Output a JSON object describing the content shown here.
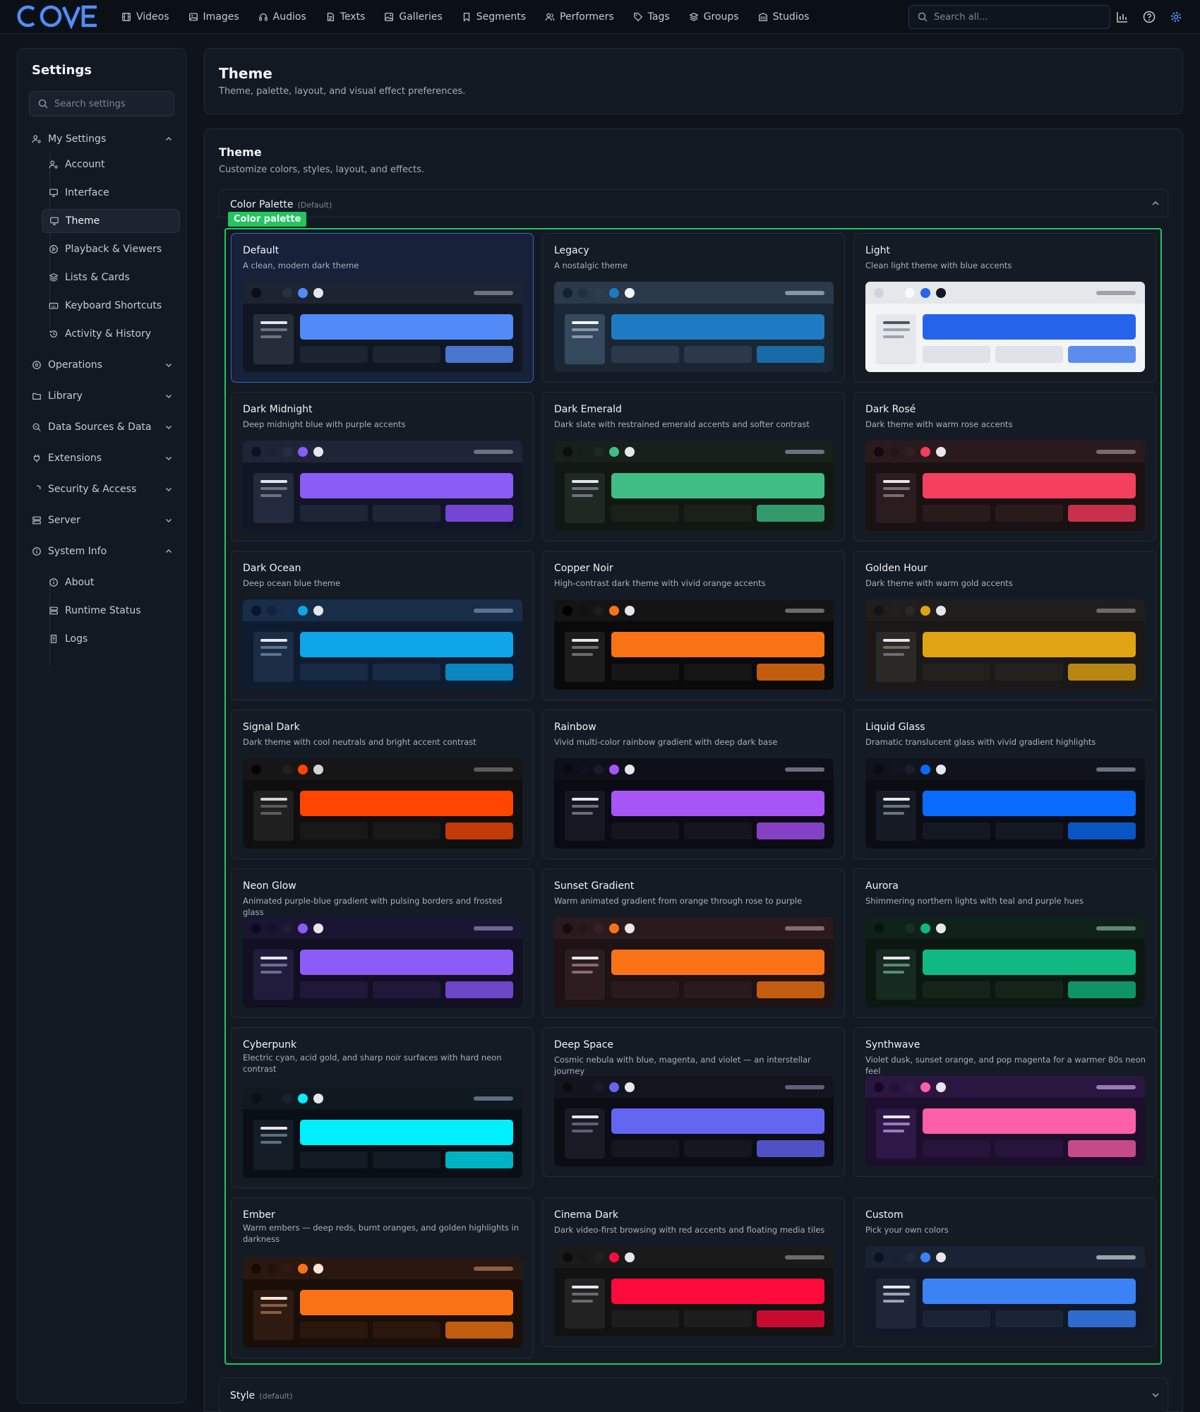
{
  "app": {
    "logo": "COVE",
    "search_placeholder": "Search all..."
  },
  "nav": [
    {
      "label": "Videos",
      "icon": "film-icon"
    },
    {
      "label": "Images",
      "icon": "image-icon"
    },
    {
      "label": "Audios",
      "icon": "headphones-icon"
    },
    {
      "label": "Texts",
      "icon": "file-text-icon"
    },
    {
      "label": "Galleries",
      "icon": "gallery-icon"
    },
    {
      "label": "Segments",
      "icon": "bookmark-icon"
    },
    {
      "label": "Performers",
      "icon": "users-icon"
    },
    {
      "label": "Tags",
      "icon": "tag-icon"
    },
    {
      "label": "Groups",
      "icon": "layers-icon"
    },
    {
      "label": "Studios",
      "icon": "building-icon"
    }
  ],
  "sidebar": {
    "title": "Settings",
    "search_placeholder": "Search settings",
    "groups": [
      {
        "label": "My Settings",
        "icon": "user-cog-icon",
        "expanded": true
      },
      {
        "label": "Operations",
        "icon": "disc-icon",
        "expanded": false
      },
      {
        "label": "Library",
        "icon": "folder-icon",
        "expanded": false
      },
      {
        "label": "Data Sources & Data",
        "icon": "database-search-icon",
        "expanded": false
      },
      {
        "label": "Extensions",
        "icon": "plug-icon",
        "expanded": false
      },
      {
        "label": "Security & Access",
        "icon": "shield-icon",
        "expanded": false
      },
      {
        "label": "Server",
        "icon": "server-icon",
        "expanded": false
      },
      {
        "label": "System Info",
        "icon": "info-icon",
        "expanded": true
      }
    ],
    "my_settings_items": [
      {
        "label": "Account",
        "icon": "user-cog-icon"
      },
      {
        "label": "Interface",
        "icon": "monitor-icon"
      },
      {
        "label": "Theme",
        "icon": "monitor-icon",
        "active": true
      },
      {
        "label": "Playback & Viewers",
        "icon": "play-circle-icon"
      },
      {
        "label": "Lists & Cards",
        "icon": "layers-icon"
      },
      {
        "label": "Keyboard Shortcuts",
        "icon": "keyboard-icon"
      },
      {
        "label": "Activity & History",
        "icon": "history-icon"
      }
    ],
    "system_info_items": [
      {
        "label": "About",
        "icon": "info-icon"
      },
      {
        "label": "Runtime Status",
        "icon": "server-icon"
      },
      {
        "label": "Logs",
        "icon": "logs-icon"
      }
    ]
  },
  "header": {
    "title": "Theme",
    "subtitle": "Theme, palette, layout, and visual effect preferences."
  },
  "section": {
    "title": "Theme",
    "subtitle": "Customize colors, styles, layout, and effects."
  },
  "palette": {
    "title": "Color Palette",
    "default_tag": "(Default)",
    "highlight_label": "Color palette"
  },
  "style": {
    "title": "Style",
    "default_tag": "(default)"
  },
  "themes": [
    {
      "name": "Default",
      "desc": "A clean, modern dark theme",
      "selected": true,
      "colors": {
        "bar": "#1c2331",
        "body": "#111722",
        "dots": [
          "#0b0f16",
          "#1c2331",
          "#283142"
        ],
        "accent": "#528bf7",
        "light": "#e5e7eb",
        "side": "#252d3a",
        "sub": "#1c2331",
        "acc2": "#4a75cf",
        "line": "#6b7280"
      }
    },
    {
      "name": "Legacy",
      "desc": "A nostalgic theme",
      "colors": {
        "bar": "#2a3a4a",
        "body": "#1a2633",
        "dots": [
          "#142230",
          "#1f3040",
          "#2c3e50"
        ],
        "accent": "#1e7ac2",
        "light": "#f3f4f6",
        "side": "#34495e",
        "sub": "#2a3a4a",
        "acc2": "#1a6aa8",
        "line": "#8896a4"
      }
    },
    {
      "name": "Light",
      "desc": "Clean light theme with blue accents",
      "colors": {
        "bar": "#e5e7eb",
        "body": "#f3f4f6",
        "dots": [
          "#d1d5db",
          "#e5e7eb",
          "#f9fafb"
        ],
        "accent": "#2563eb",
        "light": "#111827",
        "side": "#e5e7eb",
        "sub": "#dfe2e8",
        "acc2": "#5b8def",
        "line": "#9ca3af",
        "lnc": "#4b5563"
      }
    },
    {
      "name": "Dark Midnight",
      "desc": "Deep midnight blue with purple accents",
      "colors": {
        "bar": "#1e2537",
        "body": "#111627",
        "dots": [
          "#0c1120",
          "#1b2236",
          "#252d45"
        ],
        "accent": "#8b5cf6",
        "light": "#e5e7eb",
        "side": "#222a3c",
        "sub": "#1e2537",
        "acc2": "#7446d3",
        "line": "#6b7280"
      }
    },
    {
      "name": "Dark Emerald",
      "desc": "Dark slate with restrained emerald accents and softer contrast",
      "colors": {
        "bar": "#172019",
        "body": "#111813",
        "dots": [
          "#0b100c",
          "#162019",
          "#1e2a21"
        ],
        "accent": "#3fbe83",
        "light": "#e5e7eb",
        "side": "#1f2922",
        "sub": "#192119",
        "acc2": "#339b6b",
        "line": "#6b7280"
      }
    },
    {
      "name": "Dark Rosé",
      "desc": "Dark theme with warm rose accents",
      "colors": {
        "bar": "#2b1a1c",
        "body": "#1a1113",
        "dots": [
          "#120a0c",
          "#231517",
          "#351f22"
        ],
        "accent": "#f43f5e",
        "light": "#e5e7eb",
        "side": "#2b1d1f",
        "sub": "#2b1a1c",
        "acc2": "#c9304a",
        "line": "#7a6b6e"
      }
    },
    {
      "name": "Dark Ocean",
      "desc": "Deep ocean blue theme",
      "colors": {
        "bar": "#182d4a",
        "body": "#0f1c30",
        "dots": [
          "#0b1526",
          "#13233c",
          "#1a2f4d"
        ],
        "accent": "#0ea5e9",
        "light": "#e5e7eb",
        "side": "#1b2c45",
        "sub": "#182a44",
        "acc2": "#0b86c0",
        "line": "#5b7290"
      }
    },
    {
      "name": "Copper Noir",
      "desc": "High-contrast dark theme with vivid orange accents",
      "colors": {
        "bar": "#141414",
        "body": "#0a0a0a",
        "dots": [
          "#000000",
          "#111111",
          "#1c1c1c"
        ],
        "accent": "#f97316",
        "light": "#e5e7eb",
        "side": "#1c1c1c",
        "sub": "#161616",
        "acc2": "#c25c0e",
        "line": "#6b6b6b"
      }
    },
    {
      "name": "Golden Hour",
      "desc": "Dark theme with warm gold accents",
      "colors": {
        "bar": "#1f1e1c",
        "body": "#1a1917",
        "dots": [
          "#141311",
          "#22211e",
          "#2b2a26"
        ],
        "accent": "#e0a413",
        "light": "#e5e7eb",
        "side": "#2a2926",
        "sub": "#22211e",
        "acc2": "#b88713",
        "line": "#6b6b6b"
      }
    },
    {
      "name": "Signal Dark",
      "desc": "Dark theme with cool neutrals and bright accent contrast",
      "colors": {
        "bar": "#161616",
        "body": "#0f0f0f",
        "dots": [
          "#050505",
          "#141414",
          "#202020"
        ],
        "accent": "#ff4500",
        "light": "#d4d4d4",
        "side": "#1f1f1f",
        "sub": "#181818",
        "acc2": "#c23a06",
        "line": "#5c5c5c"
      }
    },
    {
      "name": "Rainbow",
      "desc": "Vivid multi-color rainbow gradient with deep dark base",
      "colors": {
        "bar": "#0f0f1a",
        "body": "#0b0b14",
        "dots": [
          "#0a0a12",
          "#12121e",
          "#1a1a28"
        ],
        "accent": "#a855f7",
        "light": "#e5e7eb",
        "side": "#171723",
        "sub": "#151520",
        "acc2": "#8541c4",
        "line": "#6b6b7a"
      }
    },
    {
      "name": "Liquid Glass",
      "desc": "Dramatic translucent glass with vivid gradient highlights",
      "colors": {
        "bar": "#10131b",
        "body": "#0b0d14",
        "dots": [
          "#0a0c12",
          "#121520",
          "#1a1e2a"
        ],
        "accent": "#0a6cff",
        "light": "#e5e7eb",
        "side": "#161a24",
        "sub": "#141822",
        "acc2": "#0a55c4",
        "line": "#6b7280"
      }
    },
    {
      "name": "Neon Glow",
      "desc": "Animated purple-blue gradient with pulsing borders and frosted glass",
      "colors": {
        "bar": "#1a1533",
        "body": "#120f22",
        "dots": [
          "#0d0a1c",
          "#16122b",
          "#221c3c"
        ],
        "accent": "#8b5cf6",
        "light": "#e5e7eb",
        "side": "#221c3c",
        "sub": "#1f1838",
        "acc2": "#6d46c7",
        "line": "#6b6b8f"
      }
    },
    {
      "name": "Sunset Gradient",
      "desc": "Warm animated gradient from orange through rose to purple",
      "colors": {
        "bar": "#2a1a1d",
        "body": "#1e1214",
        "dots": [
          "#140c0e",
          "#241619",
          "#34202a"
        ],
        "accent": "#f97316",
        "light": "#e5e7eb",
        "side": "#2d1c20",
        "sub": "#2a1a1d",
        "acc2": "#c25c0e",
        "line": "#8a6a6a"
      }
    },
    {
      "name": "Aurora",
      "desc": "Shimmering northern lights with teal and purple hues",
      "colors": {
        "bar": "#0f2118",
        "body": "#0c1712",
        "dots": [
          "#081410",
          "#102218",
          "#163020"
        ],
        "accent": "#10b981",
        "light": "#e5e7eb",
        "side": "#162a1f",
        "sub": "#14241b",
        "acc2": "#0e9466",
        "line": "#5a8a70"
      }
    },
    {
      "name": "Cyberpunk",
      "desc": "Electric cyan, acid gold, and sharp noir surfaces with hard neon contrast",
      "colors": {
        "bar": "#101820",
        "body": "#0a0f15",
        "dots": [
          "#081018",
          "#101820",
          "#182230"
        ],
        "accent": "#00f0ff",
        "light": "#e5e7eb",
        "side": "#141c26",
        "sub": "#131b24",
        "acc2": "#00b4c2",
        "line": "#5a6e7e"
      }
    },
    {
      "name": "Deep Space",
      "desc": "Cosmic nebula with blue, magenta, and violet — an interstellar journey",
      "colors": {
        "bar": "#14141e",
        "body": "#0c0c14",
        "dots": [
          "#0a0a12",
          "#12121c",
          "#1a1a28"
        ],
        "accent": "#6366f1",
        "light": "#e5e7eb",
        "side": "#1a1a24",
        "sub": "#16161f",
        "acc2": "#4f51c4",
        "line": "#5f5f7a"
      }
    },
    {
      "name": "Synthwave",
      "desc": "Violet dusk, sunset orange, and pop magenta for a warmer 80s neon feel",
      "colors": {
        "bar": "#2a1640",
        "body": "#1c0f2b",
        "dots": [
          "#150a22",
          "#241236",
          "#301a46"
        ],
        "accent": "#ff5fa8",
        "light": "#e5e7eb",
        "side": "#2e1848",
        "sub": "#28133c",
        "acc2": "#c64a87",
        "line": "#9a7ab8"
      }
    },
    {
      "name": "Ember",
      "desc": "Warm embers — deep reds, burnt oranges, and golden highlights in darkness",
      "colors": {
        "bar": "#2a1810",
        "body": "#1a0f08",
        "dots": [
          "#140a06",
          "#221208",
          "#301a10"
        ],
        "accent": "#f97316",
        "light": "#fde6d8",
        "side": "#2e1a10",
        "sub": "#2a160c",
        "acc2": "#c25c0e",
        "line": "#8a5e42"
      }
    },
    {
      "name": "Cinema Dark",
      "desc": "Dark video-first browsing with red accents and floating media tiles",
      "colors": {
        "bar": "#1a1a1a",
        "body": "#121212",
        "dots": [
          "#0c0c0c",
          "#161616",
          "#202020"
        ],
        "accent": "#ff0a3c",
        "light": "#e5e7eb",
        "side": "#222222",
        "sub": "#1d1d1d",
        "acc2": "#c80a30",
        "line": "#6b6b6b"
      }
    },
    {
      "name": "Custom",
      "desc": "Pick your own colors",
      "colors": {
        "bar": "#1a2334",
        "body": "#111827",
        "dots": [
          "#0b1220",
          "#182132",
          "#202a3d"
        ],
        "accent": "#3b82f6",
        "light": "#e5e7eb",
        "side": "#1e2638",
        "sub": "#1b2436",
        "acc2": "#2f6bcc",
        "line": "#9aa3b0"
      }
    }
  ]
}
